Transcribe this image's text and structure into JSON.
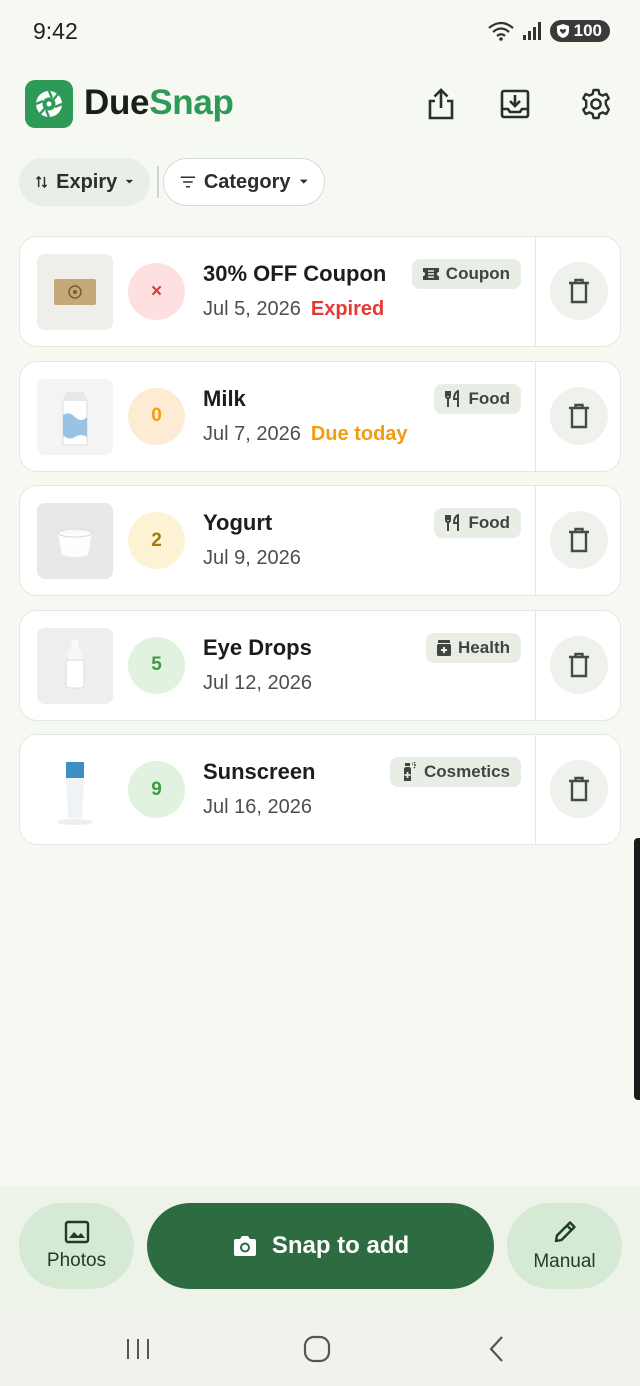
{
  "status_bar": {
    "time": "9:42",
    "battery": "100"
  },
  "header": {
    "title_part1": "Due",
    "title_part2": "Snap",
    "accent_color": "#2e9a57"
  },
  "filters": {
    "sort_label": "Expiry",
    "category_label": "Category"
  },
  "items": [
    {
      "name": "30% OFF Coupon",
      "date": "Jul 5, 2026",
      "status": "Expired",
      "status_color": "#e53935",
      "days": "×",
      "badge_bg": "#fde0df",
      "badge_fg": "#e53935",
      "tag": "Coupon",
      "tag_icon": "ticket-icon",
      "thumb": "coupon"
    },
    {
      "name": "Milk",
      "date": "Jul 7, 2026",
      "status": "Due today",
      "status_color": "#f39c12",
      "days": "0",
      "badge_bg": "#fdebd3",
      "badge_fg": "#f39c12",
      "tag": "Food",
      "tag_icon": "utensils-icon",
      "thumb": "milk"
    },
    {
      "name": "Yogurt",
      "date": "Jul 9, 2026",
      "status": "",
      "status_color": "",
      "days": "2",
      "badge_bg": "#fdf3d2",
      "badge_fg": "#a37b06",
      "tag": "Food",
      "tag_icon": "utensils-icon",
      "thumb": "yogurt"
    },
    {
      "name": "Eye Drops",
      "date": "Jul 12, 2026",
      "status": "",
      "status_color": "",
      "days": "5",
      "badge_bg": "#e1f2e0",
      "badge_fg": "#3f9a45",
      "tag": "Health",
      "tag_icon": "medicine-icon",
      "thumb": "eyedrops"
    },
    {
      "name": "Sunscreen",
      "date": "Jul 16, 2026",
      "status": "",
      "status_color": "",
      "days": "9",
      "badge_bg": "#e1f2e0",
      "badge_fg": "#3f9a45",
      "tag": "Cosmetics",
      "tag_icon": "spray-bottle-icon",
      "thumb": "sunscreen"
    }
  ],
  "actions": {
    "photos_label": "Photos",
    "snap_label": "Snap to add",
    "manual_label": "Manual"
  }
}
